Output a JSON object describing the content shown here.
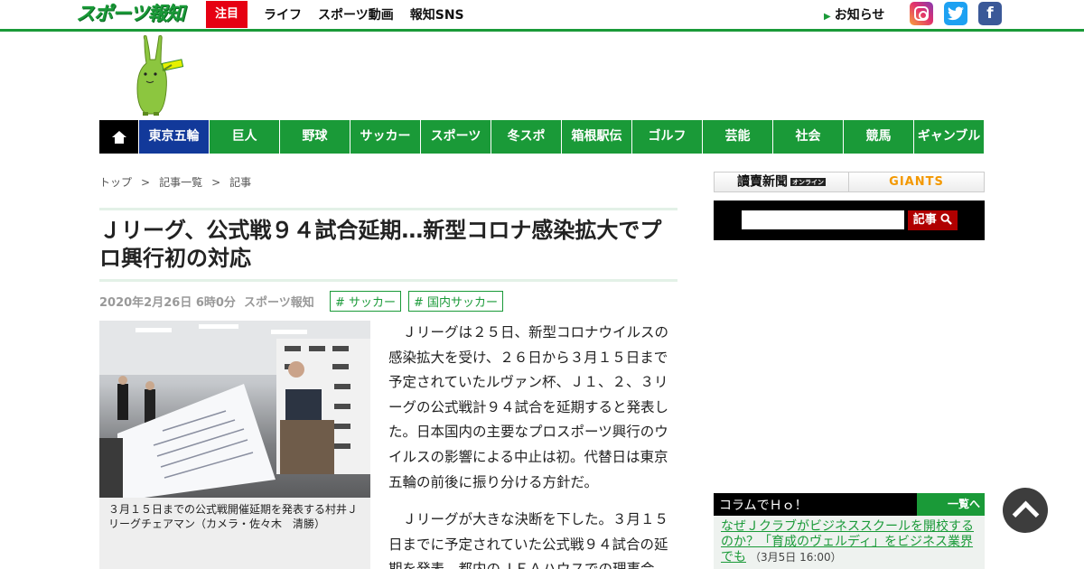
{
  "header": {
    "logo": "スポーツ報知",
    "nav": [
      {
        "label": "注目",
        "hot": true
      },
      {
        "label": "ライフ"
      },
      {
        "label": "スポーツ動画"
      },
      {
        "label": "報知SNS"
      }
    ],
    "notice": "お知らせ",
    "sns": [
      "instagram-icon",
      "twitter-icon",
      "facebook-icon"
    ],
    "accent_color": "#1a9a38"
  },
  "categories": [
    "東京五輪",
    "巨人",
    "野球",
    "サッカー",
    "スポーツ",
    "冬スポ",
    "箱根駅伝",
    "ゴルフ",
    "芸能",
    "社会",
    "競馬",
    "ギャンブル"
  ],
  "breadcrumb": [
    "トップ",
    "記事一覧",
    "記事"
  ],
  "article": {
    "title": "Ｊリーグ、公式戦９４試合延期…新型コロナ感染拡大でプロ興行初の対応",
    "date": "2020年2月26日 6時0分",
    "source": "スポーツ報知",
    "tags": [
      "# サッカー",
      "# 国内サッカー"
    ],
    "caption": "３月１５日までの公式戦開催延期を発表する村井Ｊリーグチェアマン（カメラ・佐々木　清勝）",
    "paragraphs": [
      "Ｊリーグは２５日、新型コロナウイルスの感染拡大を受け、２６日から３月１５日まで予定されていたルヴァン杯、Ｊ１、２、３リーグの公式戦計９４試合を延期すると発表した。日本国内の主要なプロスポーツ興行のウイルスの影響による中止は初。代替日は東京五輪の前後に振り分ける方針だ。",
      "Ｊリーグが大きな決断を下した。３月１５日までに予定されていた公式戦９４試合の延期を発表。都内のＪＦＡハウスでの理事会"
    ]
  },
  "sidebar": {
    "partners": [
      "讀賣新聞",
      "オンライン",
      "GIANTS"
    ],
    "search_button": "記事",
    "column": {
      "title": "コラムでＨｏ！",
      "more": "一覧へ",
      "item_title": "なぜＪクラブがビジネススクールを開校するのか？「育成のヴェルディ」をビジネス業界でも",
      "item_date": "（3月5日 16:00）"
    }
  }
}
